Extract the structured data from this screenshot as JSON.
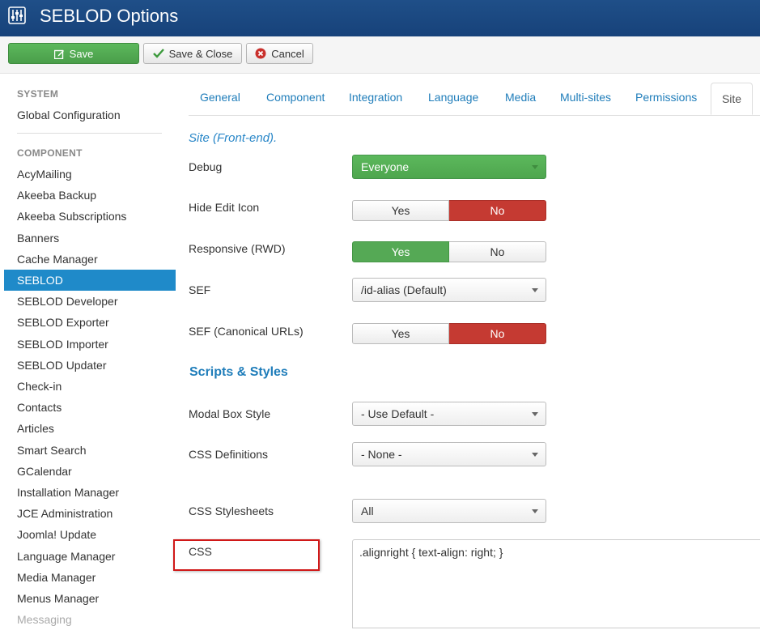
{
  "header": {
    "title": "SEBLOD Options",
    "icon": "sliders-icon"
  },
  "toolbar": {
    "save": "Save",
    "save_close": "Save & Close",
    "cancel": "Cancel"
  },
  "sidebar": {
    "system_heading": "SYSTEM",
    "global_config": "Global Configuration",
    "component_heading": "COMPONENT",
    "items": [
      "AcyMailing",
      "Akeeba Backup",
      "Akeeba Subscriptions",
      "Banners",
      "Cache Manager",
      "SEBLOD",
      "SEBLOD Developer",
      "SEBLOD Exporter",
      "SEBLOD Importer",
      "SEBLOD Updater",
      "Check-in",
      "Contacts",
      "Articles",
      "Smart Search",
      "GCalendar",
      "Installation Manager",
      "JCE Administration",
      "Joomla! Update",
      "Language Manager",
      "Media Manager",
      "Menus Manager",
      "Messaging"
    ],
    "active": "SEBLOD"
  },
  "tabs": [
    "General",
    "Component",
    "Integration",
    "Language",
    "Media",
    "Multi-sites",
    "Permissions",
    "Site"
  ],
  "active_tab": "Site",
  "form": {
    "section_site": "Site (Front-end).",
    "section_scripts": "Scripts & Styles",
    "debug": {
      "label": "Debug",
      "value": "Everyone"
    },
    "hide_edit_icon": {
      "label": "Hide Edit Icon",
      "yes": "Yes",
      "no": "No",
      "selected": "No"
    },
    "responsive": {
      "label": "Responsive (RWD)",
      "yes": "Yes",
      "no": "No",
      "selected": "Yes"
    },
    "sef": {
      "label": "SEF",
      "value": "/id-alias (Default)"
    },
    "sef_canonical": {
      "label": "SEF (Canonical URLs)",
      "yes": "Yes",
      "no": "No",
      "selected": "No"
    },
    "modal_box_style": {
      "label": "Modal Box Style",
      "value": "- Use Default -"
    },
    "css_definitions": {
      "label": "CSS Definitions",
      "value": "- None -"
    },
    "css_stylesheets": {
      "label": "CSS Stylesheets",
      "value": "All"
    },
    "css": {
      "label": "CSS",
      "value": ".alignright { text-align: right; }"
    }
  },
  "colors": {
    "header": "#1f4f88",
    "active": "#1f8ac9",
    "green": "#5cb85c",
    "red": "#c53a32",
    "highlight": "#d01818"
  }
}
